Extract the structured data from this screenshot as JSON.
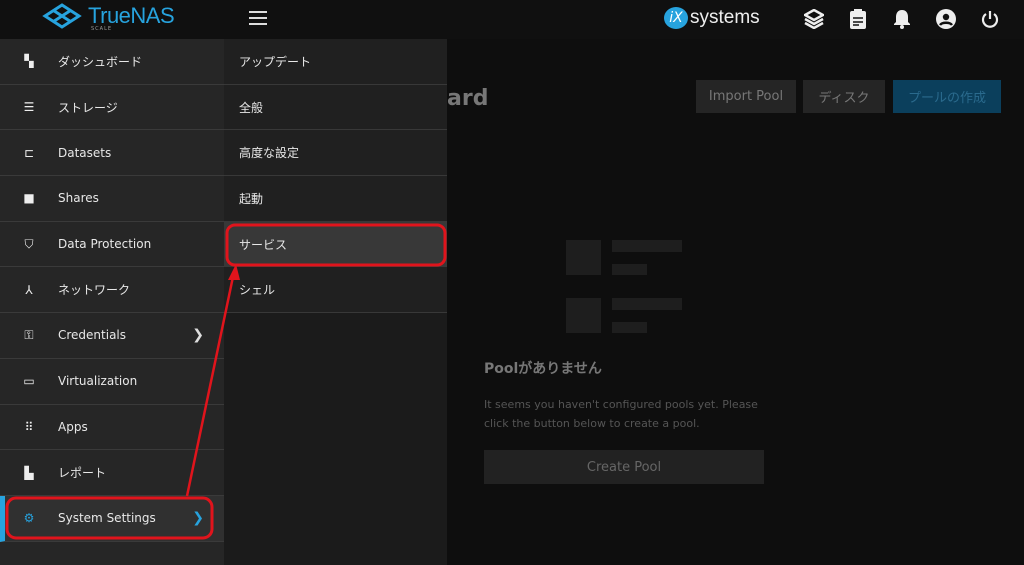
{
  "header": {
    "logo": "TrueNAS",
    "logo_sub": "SCALE",
    "vendor": "systems",
    "vendor_badge": "iX",
    "icons": [
      "truecommand-icon",
      "clipboard-icon",
      "bell-icon",
      "account-icon",
      "power-icon"
    ]
  },
  "sidebar": {
    "items": [
      {
        "label": "ダッシュボード",
        "icon": "dashboard-icon"
      },
      {
        "label": "ストレージ",
        "icon": "storage-icon"
      },
      {
        "label": "Datasets",
        "icon": "datasets-icon"
      },
      {
        "label": "Shares",
        "icon": "folder-shared-icon"
      },
      {
        "label": "Data Protection",
        "icon": "shield-icon"
      },
      {
        "label": "ネットワーク",
        "icon": "network-icon"
      },
      {
        "label": "Credentials",
        "icon": "key-icon"
      },
      {
        "label": "Virtualization",
        "icon": "laptop-icon"
      },
      {
        "label": "Apps",
        "icon": "apps-icon"
      },
      {
        "label": "レポート",
        "icon": "chart-icon"
      },
      {
        "label": "System Settings",
        "icon": "gear-icon"
      }
    ]
  },
  "submenu": {
    "items": [
      "アップデート",
      "全般",
      "高度な設定",
      "起動",
      "サービス",
      "シェル"
    ]
  },
  "main": {
    "title": "ard",
    "buttons": {
      "import": "Import Pool",
      "disks": "ディスク",
      "create": "プールの作成"
    },
    "empty": {
      "title": "Poolがありません",
      "description": "It seems you haven't configured pools yet. Please click the button below to create a pool.",
      "button": "Create Pool"
    }
  },
  "colors": {
    "accent": "#27a3de",
    "annotation": "#e0141c"
  }
}
